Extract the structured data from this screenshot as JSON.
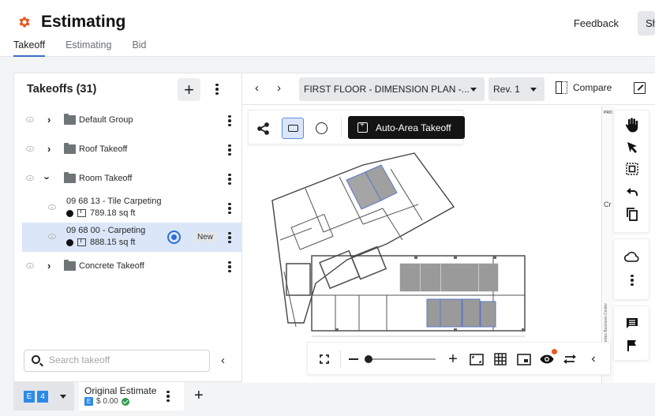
{
  "app": {
    "title": "Estimating",
    "brand_color": "#e8521f",
    "accent_color": "#2e6fd8"
  },
  "header": {
    "feedback_label": "Feedback",
    "share_label": "Share",
    "tabs": [
      {
        "label": "Takeoff",
        "active": true
      },
      {
        "label": "Estimating",
        "active": false
      },
      {
        "label": "Bid",
        "active": false
      }
    ]
  },
  "takeoffs": {
    "title": "Takeoffs (31)",
    "add_icon": "plus-icon",
    "more_icon": "kebab-icon",
    "groups": [
      {
        "label": "Default Group",
        "expanded": false
      },
      {
        "label": "Roof Takeoff",
        "expanded": false
      },
      {
        "label": "Room Takeoff",
        "expanded": true,
        "items": [
          {
            "name": "09 68 13 - Tile Carpeting",
            "quantity": "789.18 sq ft",
            "color": "#111111",
            "selected": false
          },
          {
            "name": "09 68 00 - Carpeting",
            "quantity": "888.15 sq ft",
            "color": "#111111",
            "selected": true,
            "badge": "New"
          }
        ]
      },
      {
        "label": "Concrete Takeoff",
        "expanded": false
      }
    ],
    "search": {
      "placeholder": "Search takeoff",
      "value": ""
    }
  },
  "estimate_bar": {
    "switch_badges": [
      "E",
      "4"
    ],
    "estimate_name": "Original Estimate",
    "estimate_badge": "E",
    "estimate_amount": "$ 0.00",
    "estimate_status": "check-circle-icon",
    "add_icon": "plus-icon"
  },
  "viewer": {
    "sheet_name": "FIRST FLOOR - DIMENSION PLAN -...",
    "revision": "Rev. 1",
    "compare_label": "Compare",
    "tools": {
      "polyline": "polyline-icon",
      "rectangle": "rectangle-icon",
      "circle": "circle-icon",
      "auto_area_label": "Auto-Area Takeoff"
    },
    "right_tools": [
      "hand-icon",
      "pointer-icon",
      "select-area-icon",
      "undo-icon",
      "copy-icon",
      "cloud-icon",
      "more-icon",
      "comment-icon",
      "flag-icon"
    ],
    "title_block": {
      "top_text": "PRO",
      "side_text": "Vortex Business Center",
      "cr_text": "Cr"
    },
    "view_controls": {
      "zoom_level": 0.0,
      "icons": [
        "fullscreen-icon",
        "zoom-out-icon",
        "zoom-in-icon",
        "fit-icon",
        "grid-icon",
        "minimap-icon",
        "visibility-icon",
        "swap-icon",
        "collapse-icon"
      ],
      "visibility_notification": true,
      "notification_color": "#ee5a24"
    }
  }
}
